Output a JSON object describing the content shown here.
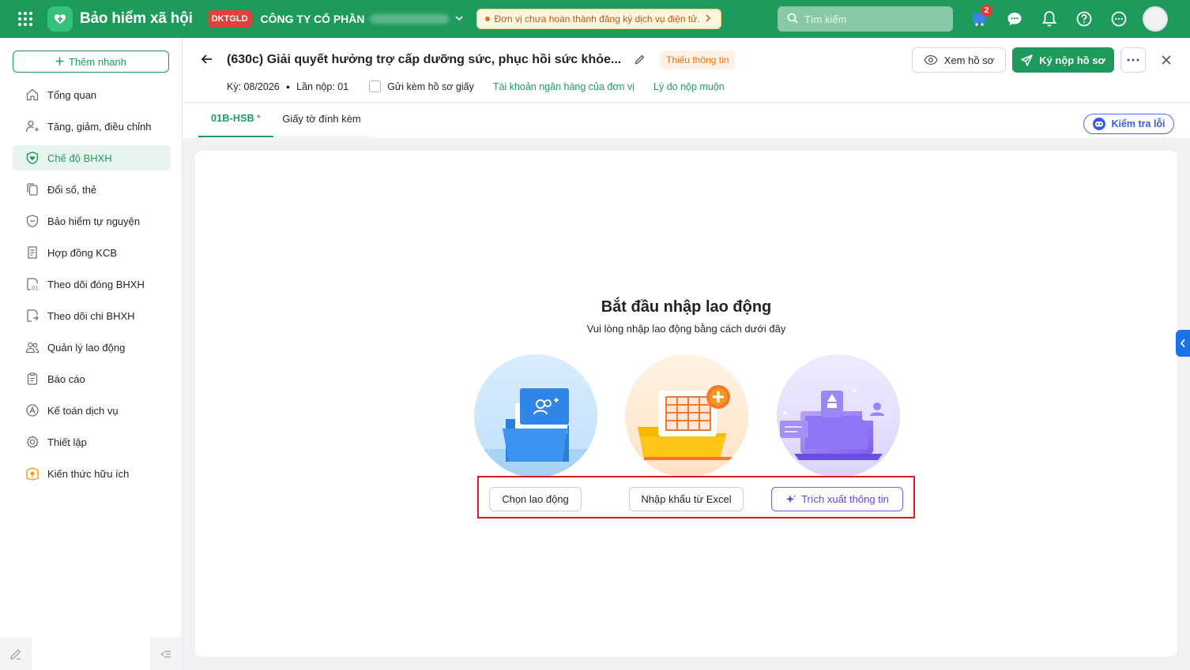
{
  "topbar": {
    "app_title": "Bảo hiểm xã hội",
    "company_code": "DKTGLD",
    "company_name": "CÔNG TY CỔ PHẦN",
    "alert_text": "Đơn vị chưa hoàn thành đăng ký dịch vụ điện tử.",
    "search_placeholder": "Tìm kiếm",
    "cart_count": "2"
  },
  "sidebar": {
    "quick_add": "Thêm nhanh",
    "items": [
      {
        "label": "Tổng quan",
        "icon": "home-icon"
      },
      {
        "label": "Tăng, giảm, điều chỉnh",
        "icon": "user-adjust-icon"
      },
      {
        "label": "Chế độ BHXH",
        "icon": "heart-shield-icon",
        "active": true
      },
      {
        "label": "Đổi sổ, thẻ",
        "icon": "copy-icon"
      },
      {
        "label": "Bảo hiểm tự nguyện",
        "icon": "shield-icon"
      },
      {
        "label": "Hợp đồng KCB",
        "icon": "contract-icon"
      },
      {
        "label": "Theo dõi đóng BHXH",
        "icon": "calendar-icon"
      },
      {
        "label": "Theo dõi chi BHXH",
        "icon": "payout-icon"
      },
      {
        "label": "Quản lý lao động",
        "icon": "users-icon"
      },
      {
        "label": "Báo cáo",
        "icon": "report-icon"
      },
      {
        "label": "Kế toán dịch vụ",
        "icon": "accounting-icon"
      },
      {
        "label": "Thiết lập",
        "icon": "gear-icon"
      },
      {
        "label": "Kiến thức hữu ích",
        "icon": "knowledge-icon"
      }
    ]
  },
  "header": {
    "title": "(630c) Giải quyết hưởng trợ cấp dưỡng sức, phục hồi sức khỏe...",
    "status_tag": "Thiếu thông tin",
    "period": "Kỳ: 08/2026",
    "submission": "Lần nộp: 01",
    "paper_checkbox_label": "Gửi kèm hồ sơ giấy",
    "bank_link": "Tài khoản ngân hàng của đơn vị",
    "late_reason_link": "Lý do nộp muộn",
    "view_button": "Xem hồ sơ",
    "sign_button": "Ký nộp hồ sơ"
  },
  "tabs": {
    "form_tab": "01B-HSB",
    "form_tab_required": "*",
    "attachments_tab": "Giấy tờ đính kèm",
    "check_errors_button": "Kiểm tra lỗi"
  },
  "main": {
    "empty_title": "Bắt đầu nhập lao động",
    "empty_subtitle": "Vui lòng nhập lao động bằng cách dưới đây",
    "option_choose": "Chọn lao động",
    "option_import": "Nhập khẩu từ Excel",
    "option_extract": "Trích xuất thông tin"
  },
  "colors": {
    "brand": "#1e9b5c",
    "alert": "#e8720c",
    "highlight": "#d91c1c",
    "ai_accent": "#7b5cf0"
  }
}
